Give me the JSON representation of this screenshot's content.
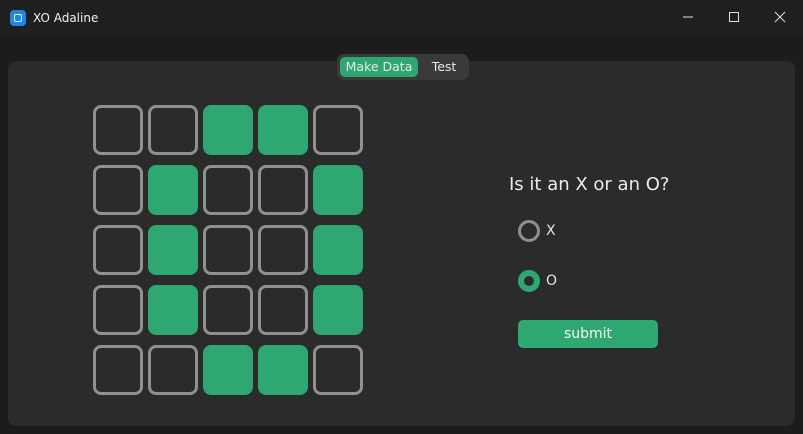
{
  "window": {
    "title": "XO Adaline",
    "icon": "app-icon"
  },
  "tabs": [
    {
      "label": "Make Data",
      "selected": true
    },
    {
      "label": "Test",
      "selected": false
    }
  ],
  "grid": {
    "rows": 5,
    "cols": 5,
    "cells": [
      [
        0,
        0,
        1,
        1,
        0
      ],
      [
        0,
        1,
        0,
        0,
        1
      ],
      [
        0,
        1,
        0,
        0,
        1
      ],
      [
        0,
        1,
        0,
        0,
        1
      ],
      [
        0,
        0,
        1,
        1,
        0
      ]
    ]
  },
  "form": {
    "question": "Is it an X or an O?",
    "options": [
      {
        "label": "X",
        "checked": false
      },
      {
        "label": "O",
        "checked": true
      }
    ],
    "submit_label": "submit"
  },
  "colors": {
    "accent": "#2ea773",
    "background": "#2b2b2b",
    "cell_border": "#909090"
  }
}
